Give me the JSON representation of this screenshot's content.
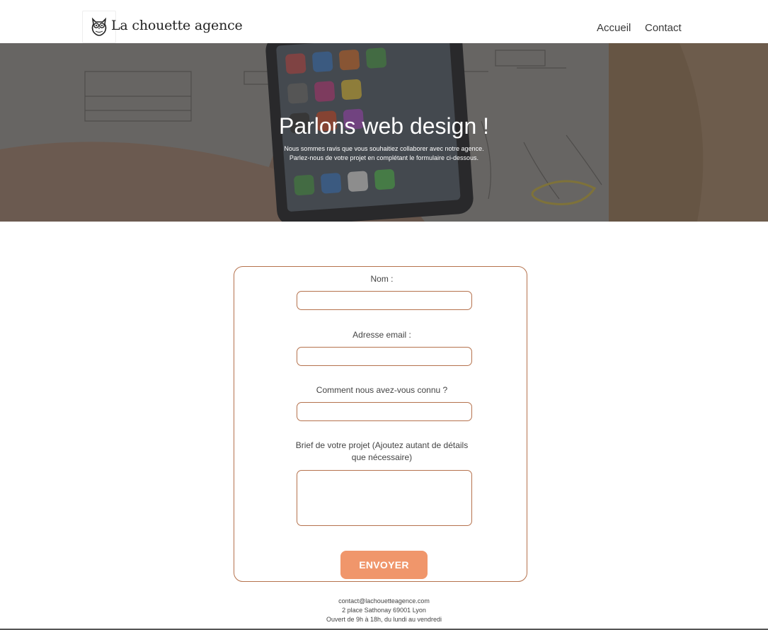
{
  "header": {
    "brand": "La chouette agence",
    "nav": [
      {
        "label": "Accueil"
      },
      {
        "label": "Contact"
      }
    ]
  },
  "hero": {
    "title": "Parlons web design !",
    "subtitle_line1": "Nous sommes ravis que vous souhaitiez collaborer avec notre agence.",
    "subtitle_line2": "Parlez-nous de votre projet en complétant le formulaire ci-dessous."
  },
  "form": {
    "name_label": "Nom :",
    "name_value": "",
    "email_label": "Adresse email :",
    "email_value": "",
    "source_label": "Comment nous avez-vous connu ?",
    "source_value": "",
    "brief_label_line1": "Brief de votre projet (Ajoutez autant de détails",
    "brief_label_line2": "que nécessaire)",
    "brief_value": "",
    "submit_label": "ENVOYER"
  },
  "footer": {
    "email": "contact@lachouetteagence.com",
    "address": "2 place Sathonay 69001 Lyon",
    "hours": "Ouvert de 9h à 18h, du lundi au vendredi"
  },
  "colors": {
    "accent": "#f0966b",
    "border": "#b5724d"
  },
  "icons": [
    "owl-logo-icon",
    "resize-grip-icon"
  ]
}
